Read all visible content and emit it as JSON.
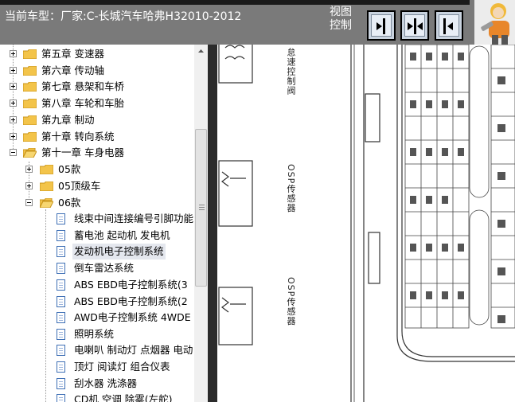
{
  "header": {
    "car_model": "当前车型：厂家:C-长城汽车哈弗H32010-2012",
    "view_control": "视图控制",
    "view_buttons": [
      {
        "id": "left",
        "icon": "arrow-right-to-bar-icon"
      },
      {
        "id": "both",
        "icon": "arrows-both-icon"
      },
      {
        "id": "right",
        "icon": "arrow-left-from-bar-icon"
      }
    ]
  },
  "tree": {
    "chapters": [
      {
        "label": "第五章 变速器",
        "expanded": false
      },
      {
        "label": "第六章 传动轴",
        "expanded": false
      },
      {
        "label": "第七章 悬架和车桥",
        "expanded": false
      },
      {
        "label": "第八章 车轮和车胎",
        "expanded": false
      },
      {
        "label": "第九章 制动",
        "expanded": false
      },
      {
        "label": "第十章 转向系统",
        "expanded": false
      },
      {
        "label": "第十一章 车身电器",
        "expanded": true
      }
    ],
    "subfolders": [
      {
        "label": "05款",
        "expanded": false
      },
      {
        "label": "05顶级车",
        "expanded": false
      },
      {
        "label": "06款",
        "expanded": true
      }
    ],
    "documents": [
      {
        "label": "线束中间连接编号引脚功能"
      },
      {
        "label": "蓄电池 起动机 发电机"
      },
      {
        "label": "发动机电子控制系统",
        "selected": true
      },
      {
        "label": "倒车雷达系统"
      },
      {
        "label": "ABS EBD电子控制系统(3"
      },
      {
        "label": "ABS EBD电子控制系统(2"
      },
      {
        "label": "AWD电子控制系统 4WDE"
      },
      {
        "label": "照明系统"
      },
      {
        "label": "电喇叭 制动灯 点烟器 电动"
      },
      {
        "label": "顶灯 阅读灯 组合仪表"
      },
      {
        "label": "刮水器 洗涤器"
      },
      {
        "label": "CD机 空调 除雾(左舵)"
      }
    ]
  },
  "diagram": {
    "labels": {
      "idle_valve": "怠速控制阀",
      "o2_sensor_1": "OSP传感器",
      "o2_sensor_2": "OSP传感器"
    }
  },
  "colors": {
    "header_bg": "#7a7a7a",
    "selection_bg": "#e4e7ee",
    "folder": "#f3c44a"
  }
}
